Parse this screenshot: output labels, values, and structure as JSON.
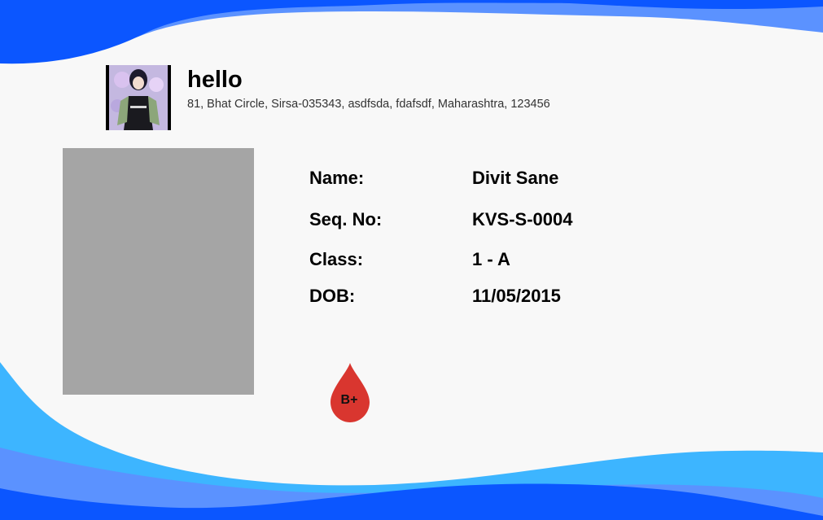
{
  "school": {
    "name": "hello",
    "address": "81, Bhat Circle, Sirsa-035343, asdfsda, fdafsdf, Maharashtra, 123456"
  },
  "fields": [
    {
      "label": "Name:",
      "value": "Divit Sane"
    },
    {
      "label": "Seq. No:",
      "value": "KVS-S-0004"
    },
    {
      "label": "Class:",
      "value": "1 - A"
    },
    {
      "label": "DOB:",
      "value": "11/05/2015"
    }
  ],
  "blood_group": "B+",
  "colors": {
    "wave_dark": "#0b56ff",
    "wave_mid": "#5b92ff",
    "wave_light": "#3db5ff",
    "photo_placeholder": "#a5a5a5",
    "blood_drop": "#d9362f",
    "background": "#f8f8f8"
  },
  "icons": {
    "logo": "anime-character-logo",
    "blood": "blood-drop-icon"
  }
}
